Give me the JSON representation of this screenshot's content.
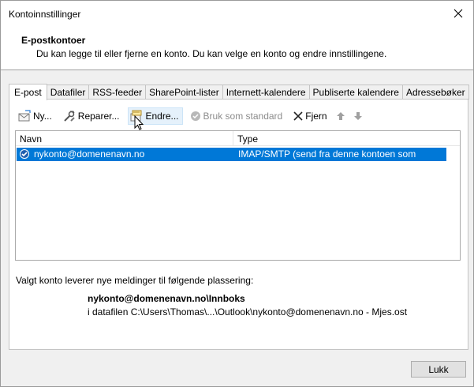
{
  "window": {
    "title": "Kontoinnstillinger",
    "close_icon": "close-icon"
  },
  "header": {
    "title": "E-postkontoer",
    "description": "Du kan legge til eller fjerne en konto. Du kan velge en konto og endre innstillingene."
  },
  "tabs": [
    {
      "label": "E-post",
      "active": true
    },
    {
      "label": "Datafiler"
    },
    {
      "label": "RSS-feeder"
    },
    {
      "label": "SharePoint-lister"
    },
    {
      "label": "Internett-kalendere"
    },
    {
      "label": "Publiserte kalendere"
    },
    {
      "label": "Adressebøker"
    }
  ],
  "toolbar": {
    "new_label": "Ny...",
    "repair_label": "Reparer...",
    "change_label": "Endre...",
    "set_default_label": "Bruk som standard",
    "remove_label": "Fjern"
  },
  "accounts_list": {
    "columns": {
      "name": "Navn",
      "type": "Type"
    },
    "rows": [
      {
        "name": "nykonto@domenenavn.no",
        "type": "IMAP/SMTP (send fra denne kontoen som standard)",
        "selected": true
      }
    ]
  },
  "delivery": {
    "label": "Valgt konto leverer nye meldinger til følgende plassering:",
    "folder": "nykonto@domenenavn.no\\Innboks",
    "file": "i datafilen C:\\Users\\Thomas\\...\\Outlook\\nykonto@domenenavn.no - Mjes.ost"
  },
  "footer": {
    "close_label": "Lukk"
  },
  "colors": {
    "selection": "#0078d7",
    "dialog_bg": "#f0f0f0",
    "hover_bg": "#e5f1fb"
  }
}
